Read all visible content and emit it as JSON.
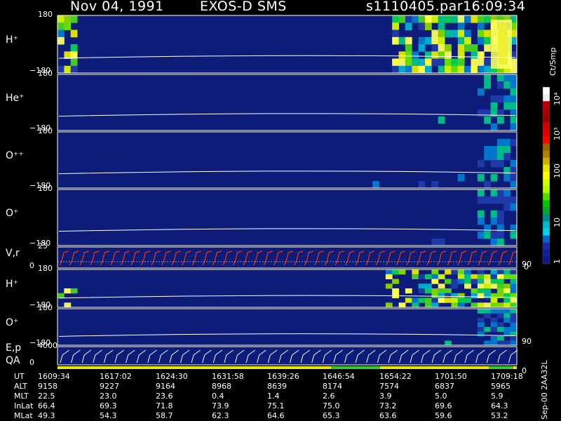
{
  "header": {
    "date": "Nov 04, 1991",
    "instrument": "EXOS-D SMS",
    "file": "s1110405.par",
    "time": "16:09:34"
  },
  "panels": [
    {
      "label": "H⁺",
      "top": "180",
      "bottom": "−180",
      "intensity": "high"
    },
    {
      "label": "He⁺",
      "top": "180",
      "bottom": "−180",
      "intensity": "low"
    },
    {
      "label": "O⁺⁺",
      "top": "180",
      "bottom": "−180",
      "intensity": "low"
    },
    {
      "label": "O⁺",
      "top": "180",
      "bottom": "−180",
      "intensity": "low"
    },
    {
      "label": "V,r",
      "top": "25",
      "bottom": "0",
      "right": "90",
      "right_bottom": "0",
      "kind": "velocity"
    },
    {
      "label": "H⁺",
      "top": "180",
      "bottom": "−180",
      "intensity": "mid"
    },
    {
      "label": "O⁺",
      "top": "180",
      "bottom": "−180",
      "intensity": "low2",
      "right": "90"
    },
    {
      "label": "E,p",
      "label2": "QA",
      "top": "4000",
      "bottom": "0",
      "right": "0",
      "kind": "energy"
    }
  ],
  "colorbar": {
    "unit": "Ct/Smp",
    "ticks": [
      "10⁴",
      "10³",
      "100",
      "10",
      "1"
    ],
    "colors": [
      "#ffffff",
      "#f0f0f0",
      "#bb0000",
      "#aa0000",
      "#990000",
      "#cc0000",
      "#e00000",
      "#ff0000",
      "#996600",
      "#b08000",
      "#c8b400",
      "#e6e600",
      "#ffff00",
      "#d4ff00",
      "#aaff00",
      "#55dd00",
      "#00c800",
      "#00aa33",
      "#008c8c",
      "#00bbcc",
      "#00d4e6",
      "#0066cc",
      "#1a2aa0",
      "#14209a",
      "#101888"
    ]
  },
  "footer": {
    "rows": [
      {
        "name": "UT",
        "values": [
          "1609:34",
          "1617:02",
          "1624:30",
          "1631:58",
          "1639:26",
          "1646:54",
          "1654:22",
          "1701:50",
          "1709:18"
        ]
      },
      {
        "name": "ALT",
        "values": [
          "9158",
          "9227",
          "9164",
          "8968",
          "8639",
          "8174",
          "7574",
          "6837",
          "5965"
        ]
      },
      {
        "name": "MLT",
        "values": [
          "22.5",
          "23.0",
          "23.6",
          "0.4",
          "1.4",
          "2.6",
          "3.9",
          "5.0",
          "5.9"
        ]
      },
      {
        "name": "InLat",
        "values": [
          "66.4",
          "69.3",
          "71.8",
          "73.9",
          "75.1",
          "75.0",
          "73.2",
          "69.6",
          "64.3"
        ]
      },
      {
        "name": "MLat",
        "values": [
          "49.3",
          "54.3",
          "58.7",
          "62.3",
          "64.6",
          "65.3",
          "63.6",
          "59.6",
          "53.2"
        ]
      }
    ],
    "version": "Sep-00 2AA32L"
  },
  "chart_data": {
    "type": "heatmap",
    "title": "Nov 04, 1991   EXOS-D SMS",
    "x": [
      "1609:34",
      "1617:02",
      "1624:30",
      "1631:58",
      "1639:26",
      "1646:54",
      "1654:22",
      "1701:50",
      "1709:18"
    ],
    "xlabel": "UT",
    "series": [
      {
        "name": "H⁺",
        "ylim": [
          -180,
          180
        ]
      },
      {
        "name": "He⁺",
        "ylim": [
          -180,
          180
        ]
      },
      {
        "name": "O⁺⁺",
        "ylim": [
          -180,
          180
        ]
      },
      {
        "name": "O⁺",
        "ylim": [
          -180,
          180
        ]
      },
      {
        "name": "V,r",
        "ylim": [
          0,
          25
        ]
      },
      {
        "name": "H⁺",
        "ylim": [
          -180,
          180
        ]
      },
      {
        "name": "O⁺",
        "ylim": [
          -180,
          180
        ]
      },
      {
        "name": "E,p",
        "ylim": [
          0,
          4000
        ]
      }
    ],
    "colorbar_unit": "Ct/Smp",
    "colorbar_range": [
      1,
      10000
    ]
  }
}
